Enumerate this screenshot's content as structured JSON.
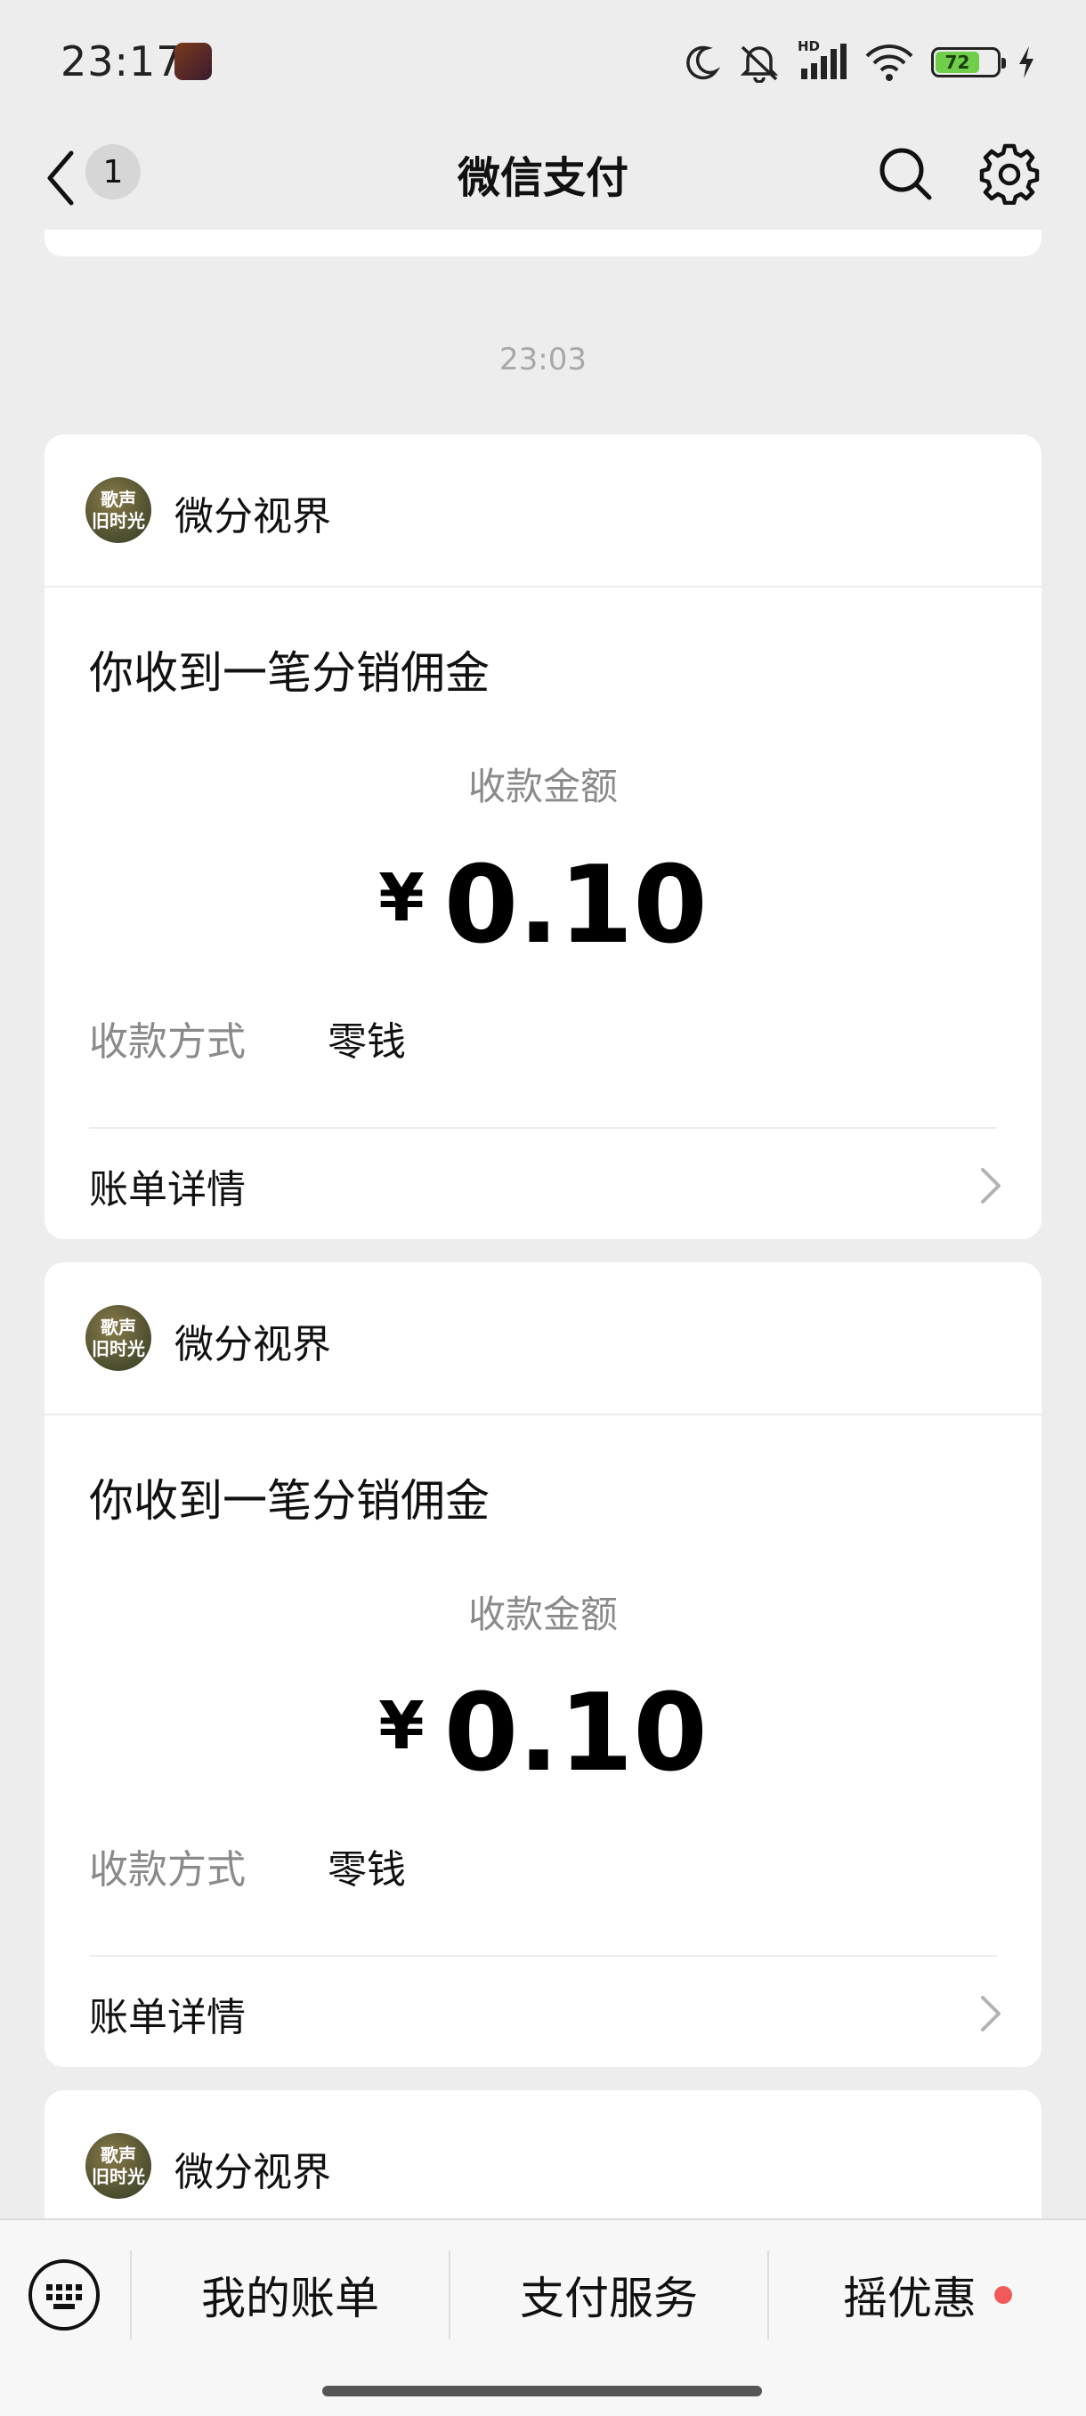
{
  "status_bar": {
    "time": "23:17",
    "battery": "72",
    "network_label": "HD",
    "icons": [
      "moon-icon",
      "mute-bell-icon",
      "signal-icon",
      "wifi-icon",
      "battery-icon",
      "charging-icon"
    ]
  },
  "nav": {
    "unread_count": "1",
    "title": "微信支付",
    "icons": [
      "back-chevron-icon",
      "search-icon",
      "gear-icon"
    ]
  },
  "timestamp": "23:03",
  "cards": [
    {
      "avatar_text": "歌声旧时光",
      "sender": "微分视界",
      "title": "你收到一笔分销佣金",
      "amount_label": "收款金额",
      "currency": "¥",
      "amount": "0.10",
      "method_label": "收款方式",
      "method_value": "零钱",
      "detail_label": "账单详情"
    },
    {
      "avatar_text": "歌声旧时光",
      "sender": "微分视界",
      "title": "你收到一笔分销佣金",
      "amount_label": "收款金额",
      "currency": "¥",
      "amount": "0.10",
      "method_label": "收款方式",
      "method_value": "零钱",
      "detail_label": "账单详情"
    },
    {
      "avatar_text": "歌声旧时光",
      "sender": "微分视界"
    }
  ],
  "bottom_bar": {
    "tabs": [
      "我的账单",
      "支付服务",
      "摇优惠"
    ],
    "accent_dot_color": "#f25a5a"
  }
}
